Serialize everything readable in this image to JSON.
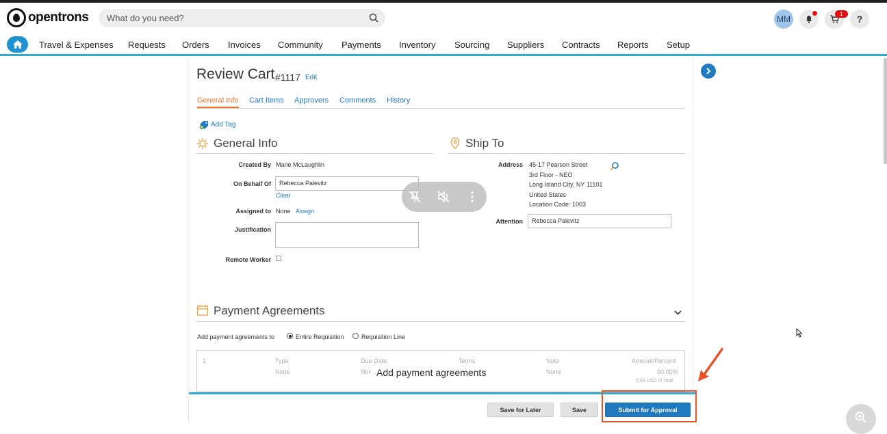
{
  "app": {
    "logo_text": "opentrons"
  },
  "search": {
    "placeholder": "What do you need?"
  },
  "header": {
    "avatar_initials": "MM",
    "cart_count": "1",
    "help_label": "?"
  },
  "nav": {
    "items": [
      "Travel & Expenses",
      "Requests",
      "Orders",
      "Invoices",
      "Community",
      "Payments",
      "Inventory",
      "Sourcing",
      "Suppliers",
      "Contracts",
      "Reports",
      "Setup"
    ]
  },
  "page": {
    "title": "Review Cart",
    "number": "#1117",
    "edit_label": "Edit"
  },
  "tabs": [
    "General Info",
    "Cart Items",
    "Approvers",
    "Comments",
    "History"
  ],
  "add_tag": "Add Tag",
  "general_info": {
    "title": "General Info",
    "created_by_label": "Created By",
    "created_by_value": "Marie McLaughlin",
    "on_behalf_label": "On Behalf Of",
    "on_behalf_value": "Rebecca Palevitz",
    "clear_label": "Clear",
    "assigned_label": "Assigned to",
    "assigned_value": "None",
    "assign_label": "Assign",
    "justification_label": "Justification",
    "remote_worker_label": "Remote Worker"
  },
  "ship_to": {
    "title": "Ship To",
    "address_label": "Address",
    "address_lines": [
      "45-17 Pearson Street",
      "3rd Floor - NEO",
      "Long Island City, NY 11101",
      "United States",
      "Location Code: 1003"
    ],
    "attention_label": "Attention",
    "attention_value": "Rebecca Palevitz"
  },
  "payment": {
    "title": "Payment Agreements",
    "add_to_label": "Add payment agreements to",
    "option_entire": "Entire Requisition",
    "option_line": "Requisition Line",
    "row_index": "1",
    "col_type": "Type",
    "col_due": "Due Date",
    "col_terms": "Terms",
    "col_note": "Note",
    "col_amount": "Amount/Percent",
    "type_val": "None",
    "due_val": "Nor",
    "note_val": "None",
    "amount_val": "00.00%",
    "total_val": "0.00 USD of Total",
    "add_label": "Add payment agreements"
  },
  "footer": {
    "save_later": "Save for Later",
    "save": "Save",
    "submit": "Submit for Approval"
  },
  "colors": {
    "accent": "#1f7ac0",
    "nav_border": "#30a9d3",
    "active_tab": "#e8742a",
    "highlight": "#e5532a"
  }
}
